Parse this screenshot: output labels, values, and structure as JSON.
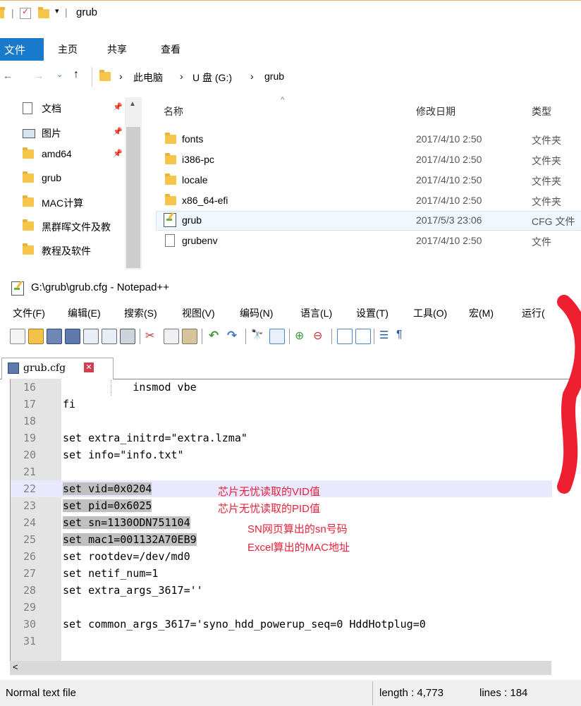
{
  "explorer": {
    "title": "grub",
    "ribbon_tabs": [
      "文件",
      "主页",
      "共享",
      "查看"
    ],
    "breadcrumb": [
      "此电脑",
      "U 盘 (G:)",
      "grub"
    ],
    "nav_items": [
      {
        "label": "文档",
        "icon": "document-icon",
        "pinned": true
      },
      {
        "label": "图片",
        "icon": "picture-icon",
        "pinned": true
      },
      {
        "label": "amd64",
        "icon": "folder-icon",
        "pinned": true
      },
      {
        "label": "grub",
        "icon": "folder-icon",
        "pinned": false
      },
      {
        "label": "MAC计算",
        "icon": "folder-icon",
        "pinned": false
      },
      {
        "label": "黑群晖文件及教",
        "icon": "folder-icon",
        "pinned": false
      },
      {
        "label": "教程及软件",
        "icon": "folder-icon",
        "pinned": false
      }
    ],
    "columns": [
      "名称",
      "修改日期",
      "类型"
    ],
    "files": [
      {
        "name": "fonts",
        "date": "2017/4/10 2:50",
        "type": "文件夹",
        "icon": "folder-icon"
      },
      {
        "name": "i386-pc",
        "date": "2017/4/10 2:50",
        "type": "文件夹",
        "icon": "folder-icon"
      },
      {
        "name": "locale",
        "date": "2017/4/10 2:50",
        "type": "文件夹",
        "icon": "folder-icon"
      },
      {
        "name": "x86_64-efi",
        "date": "2017/4/10 2:50",
        "type": "文件夹",
        "icon": "folder-icon"
      },
      {
        "name": "grub",
        "date": "2017/5/3 23:06",
        "type": "CFG 文件",
        "icon": "cfg-file-icon"
      },
      {
        "name": "grubenv",
        "date": "2017/4/10 2:50",
        "type": "文件",
        "icon": "file-icon"
      }
    ]
  },
  "notepad": {
    "title": "G:\\grub\\grub.cfg - Notepad++",
    "menu": [
      "文件(F)",
      "编辑(E)",
      "搜索(S)",
      "视图(V)",
      "编码(N)",
      "语言(L)",
      "设置(T)",
      "工具(O)",
      "宏(M)",
      "运行("
    ],
    "tab_label": "grub.cfg",
    "lines": [
      {
        "n": "16",
        "text": "           insmod vbe"
      },
      {
        "n": "17",
        "text": "fi"
      },
      {
        "n": "18",
        "text": ""
      },
      {
        "n": "19",
        "text": "set extra_initrd=\"extra.lzma\""
      },
      {
        "n": "20",
        "text": "set info=\"info.txt\""
      },
      {
        "n": "21",
        "text": ""
      },
      {
        "n": "22",
        "text": "set vid=0x0204"
      },
      {
        "n": "23",
        "text": "set pid=0x6025"
      },
      {
        "n": "24",
        "text": "set sn=1130ODN751104"
      },
      {
        "n": "25",
        "text": "set mac1=001132A70EB9"
      },
      {
        "n": "26",
        "text": "set rootdev=/dev/md0"
      },
      {
        "n": "27",
        "text": "set netif_num=1"
      },
      {
        "n": "28",
        "text": "set extra_args_3617=''"
      },
      {
        "n": "29",
        "text": ""
      },
      {
        "n": "30",
        "text": "set common_args_3617='syno_hdd_powerup_seq=0 HddHotplug=0"
      },
      {
        "n": "31",
        "text": ""
      }
    ],
    "annotations": {
      "vid": "芯片无忧读取的VID值",
      "pid": "芯片无忧读取的PID值",
      "sn": "SN网页算出的sn号码",
      "mac": "Excel算出的MAC地址"
    },
    "status": {
      "type": "Normal text file",
      "length": "length : 4,773",
      "lines": "lines : 184"
    }
  },
  "colors": {
    "accent": "#1979ca",
    "annotation": "#e8223a",
    "folder": "#f6c64c"
  }
}
